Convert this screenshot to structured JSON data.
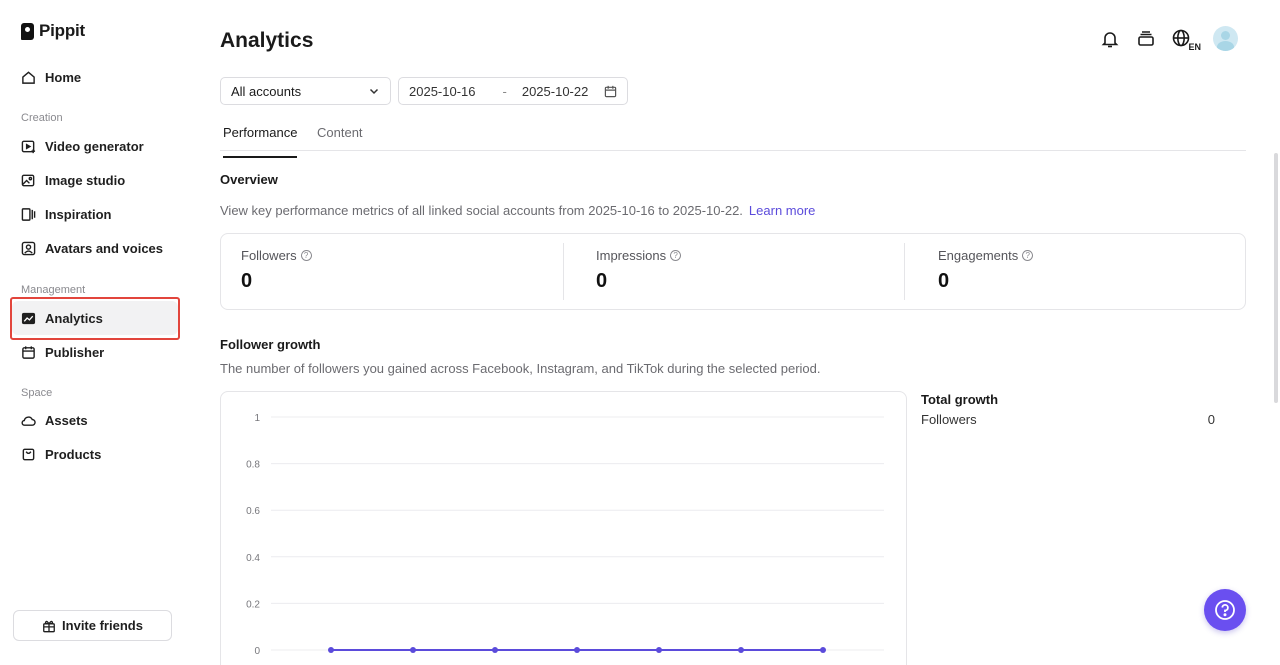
{
  "brand": {
    "name": "Pippit"
  },
  "sidebar": {
    "home": "Home",
    "sections": {
      "creation": "Creation",
      "management": "Management",
      "space": "Space"
    },
    "creation_items": [
      "Video generator",
      "Image studio",
      "Inspiration",
      "Avatars and voices"
    ],
    "management_items": [
      "Analytics",
      "Publisher"
    ],
    "space_items": [
      "Assets",
      "Products"
    ],
    "active_item": "Analytics",
    "invite_label": "Invite friends"
  },
  "header": {
    "title": "Analytics",
    "icons": [
      "bell-icon",
      "stack-icon",
      "globe-icon",
      "avatar"
    ],
    "language": "EN"
  },
  "filters": {
    "account_select": "All accounts",
    "date_start": "2025-10-16",
    "date_separator": "-",
    "date_end": "2025-10-22"
  },
  "tabs": [
    {
      "label": "Performance",
      "active": true
    },
    {
      "label": "Content",
      "active": false
    }
  ],
  "overview": {
    "title": "Overview",
    "description": "View key performance metrics of all linked social accounts from 2025-10-16 to 2025-10-22.",
    "learn_more": "Learn more",
    "stats": [
      {
        "label": "Followers",
        "value": "0"
      },
      {
        "label": "Impressions",
        "value": "0"
      },
      {
        "label": "Engagements",
        "value": "0"
      }
    ]
  },
  "follower_growth": {
    "title": "Follower growth",
    "description": "The number of followers you gained across Facebook, Instagram, and TikTok during the selected period.",
    "total_growth_title": "Total growth",
    "total_growth_label": "Followers",
    "total_growth_value": "0"
  },
  "chart_data": {
    "type": "line",
    "title": "",
    "xlabel": "",
    "ylabel": "",
    "y_ticks": [
      "1",
      "0.8",
      "0.6",
      "0.4",
      "0.2",
      "0"
    ],
    "ylim": [
      0,
      1
    ],
    "grid": true,
    "series": [
      {
        "values": [
          0,
          0,
          0,
          0,
          0,
          0,
          0
        ]
      }
    ],
    "color": "#5b4bdb"
  },
  "colors": {
    "accent": "#5b4bdb",
    "help_button": "#6a4ff0",
    "highlight": "#e2453c"
  }
}
